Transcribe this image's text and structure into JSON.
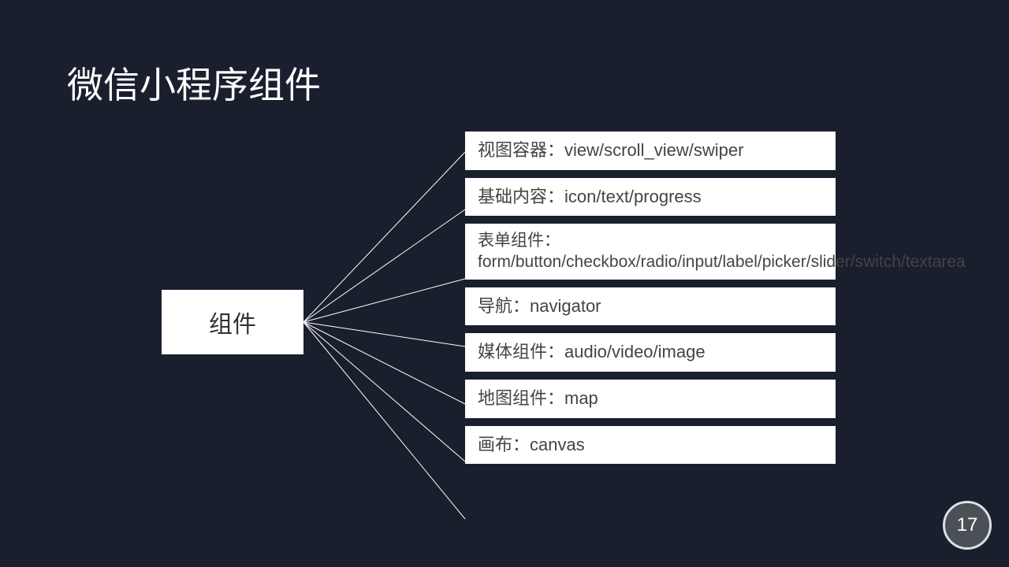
{
  "title": "微信小程序组件",
  "root": "组件",
  "items": [
    "视图容器：view/scroll_view/swiper",
    "基础内容：icon/text/progress",
    "表单组件：form/button/checkbox/radio/input/label/picker/slider/switch/textarea",
    "导航：navigator",
    "媒体组件：audio/video/image",
    "地图组件：map",
    "画布：canvas"
  ],
  "page_number": "17",
  "chart_data": {
    "type": "diagram",
    "root": "组件",
    "children": [
      "视图容器：view/scroll_view/swiper",
      "基础内容：icon/text/progress",
      "表单组件：form/button/checkbox/radio/input/label/picker/slider/switch/textarea",
      "导航：navigator",
      "媒体组件：audio/video/image",
      "地图组件：map",
      "画布：canvas"
    ]
  }
}
